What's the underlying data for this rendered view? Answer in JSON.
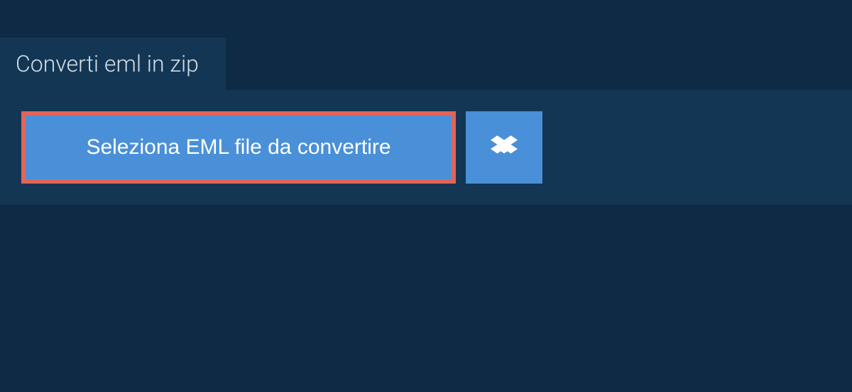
{
  "tab": {
    "title": "Converti eml in zip"
  },
  "buttons": {
    "select_file_label": "Seleziona EML file da convertire"
  },
  "colors": {
    "background": "#0f2a44",
    "panel": "#133655",
    "button": "#4a90d9",
    "highlight_border": "#e16459"
  }
}
